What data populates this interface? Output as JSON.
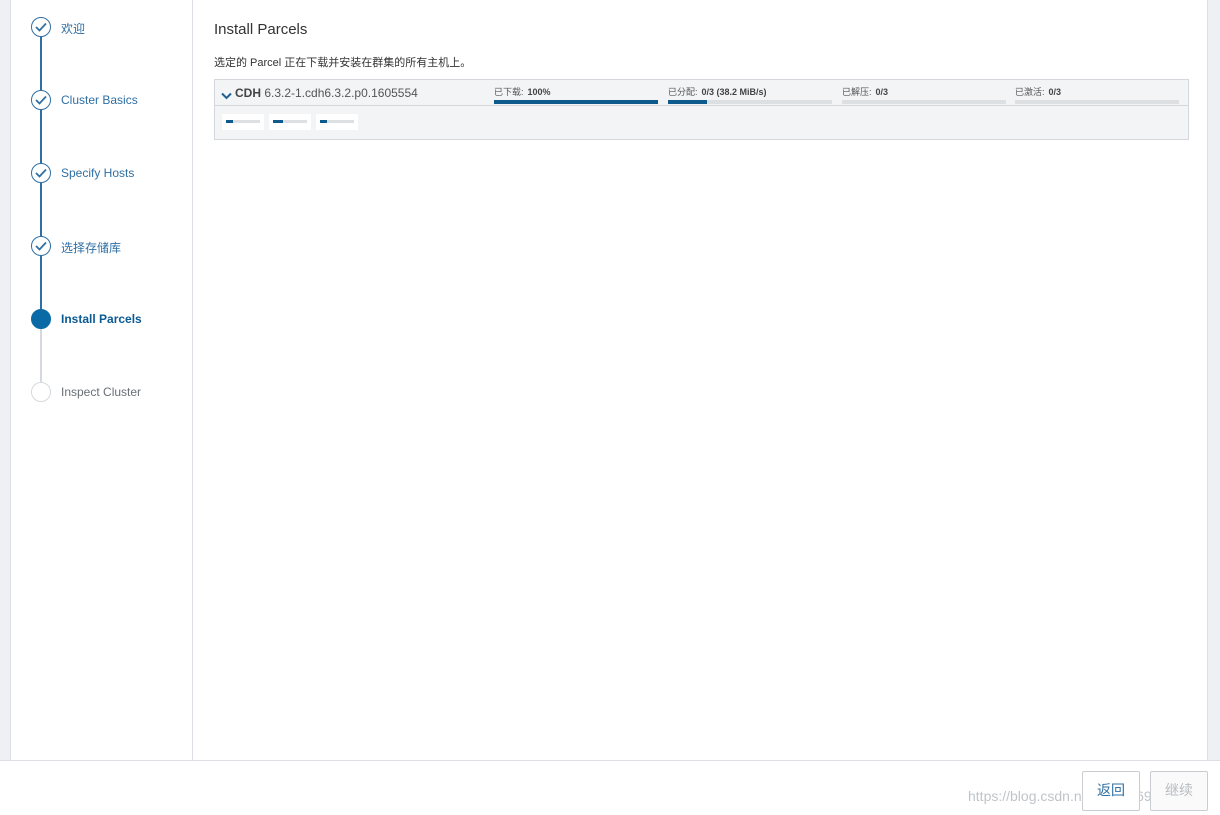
{
  "sidebar": {
    "steps": [
      {
        "label": "欢迎",
        "status": "done"
      },
      {
        "label": "Cluster Basics",
        "status": "done"
      },
      {
        "label": "Specify Hosts",
        "status": "done"
      },
      {
        "label": "选择存储库",
        "status": "done"
      },
      {
        "label": "Install Parcels",
        "status": "active"
      },
      {
        "label": "Inspect Cluster",
        "status": "pending"
      }
    ]
  },
  "main": {
    "title": "Install Parcels",
    "description": "选定的 Parcel 正在下载并安装在群集的所有主机上。",
    "parcel": {
      "name": "CDH",
      "version": "6.3.2-1.cdh6.3.2.p0.1605554",
      "stages": [
        {
          "label": "已下载:",
          "value": "100%",
          "progress": 1.0
        },
        {
          "label": "已分配:",
          "value": "0/3 (38.2 MiB/s)",
          "progress": 0.24
        },
        {
          "label": "已解压:",
          "value": "0/3",
          "progress": 0
        },
        {
          "label": "已激活:",
          "value": "0/3",
          "progress": 0
        }
      ],
      "hosts": [
        {
          "progress": 0.2
        },
        {
          "progress": 0.3
        },
        {
          "progress": 0.2
        }
      ]
    }
  },
  "footer": {
    "back_label": "返回",
    "continue_label": "继续",
    "watermark": "https://blog.csdn.net/qq_39697909"
  },
  "colors": {
    "accent": "#0a6aa6",
    "link": "#2f6fa3",
    "bar_fill": "#0d5a8c"
  }
}
